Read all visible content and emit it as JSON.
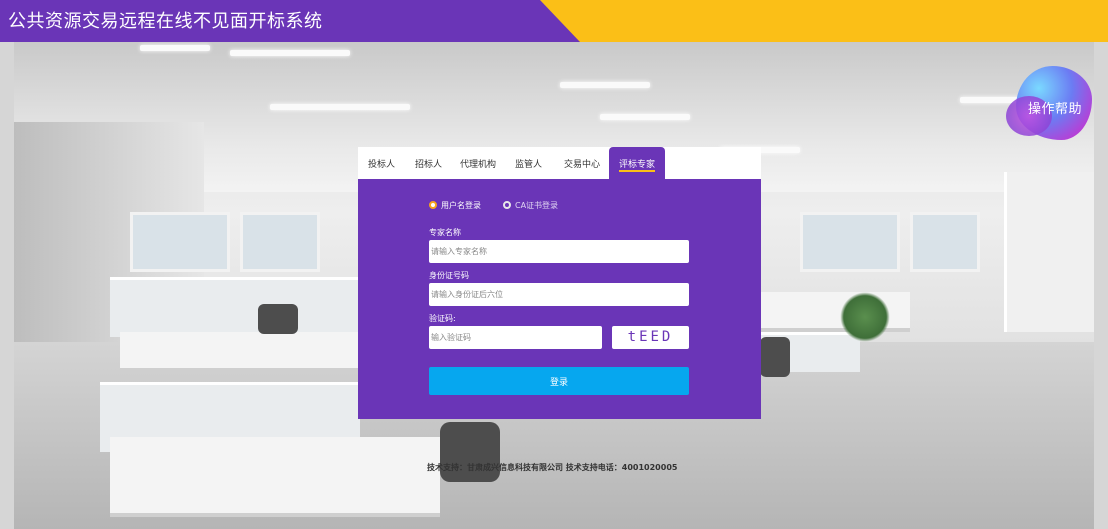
{
  "header": {
    "title": "公共资源交易远程在线不见面开标系统"
  },
  "help": {
    "label": "操作帮助"
  },
  "tabs": [
    {
      "label": "投标人"
    },
    {
      "label": "招标人"
    },
    {
      "label": "代理机构"
    },
    {
      "label": "监管人"
    },
    {
      "label": "交易中心"
    },
    {
      "label": "评标专家",
      "active": true
    }
  ],
  "login": {
    "modes": [
      {
        "label": "用户名登录",
        "selected": true
      },
      {
        "label": "CA证书登录",
        "selected": false
      }
    ],
    "fields": {
      "expert_name": {
        "label": "专家名称",
        "placeholder": "请输入专家名称"
      },
      "id_number": {
        "label": "身份证号码",
        "placeholder": "请输入身份证后六位"
      },
      "captcha": {
        "label": "验证码:",
        "placeholder": "输入验证码",
        "code": "tEED"
      }
    },
    "submit_label": "登录"
  },
  "footer": {
    "text": "技术支持：甘肃成兴信息科技有限公司  技术支持电话：4001020005"
  },
  "colors": {
    "purple": "#6a35b7",
    "yellow": "#fbbf17",
    "button": "#06a7ef"
  }
}
